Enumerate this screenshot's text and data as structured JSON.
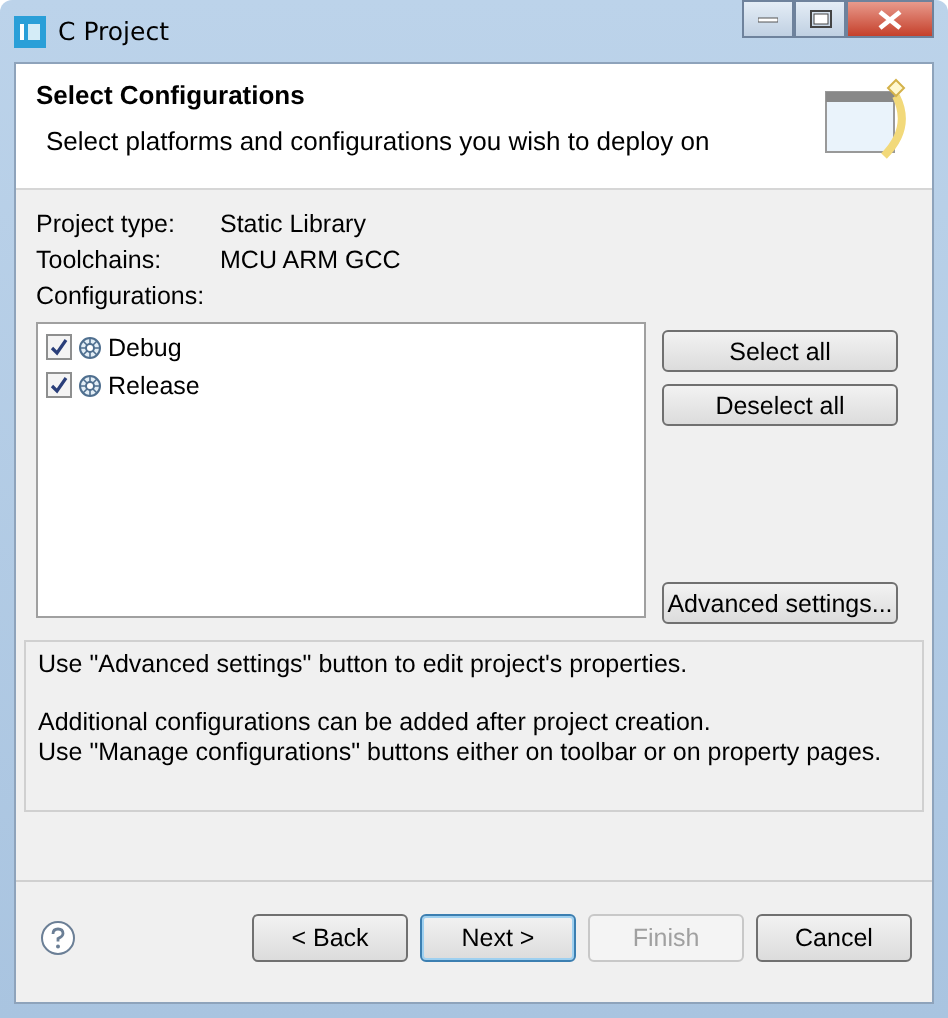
{
  "window": {
    "title": "C Project"
  },
  "header": {
    "title": "Select Configurations",
    "subtitle": "Select platforms and configurations you wish to deploy on"
  },
  "info": [
    {
      "label": "Project type:",
      "value": "Static Library"
    },
    {
      "label": "Toolchains:",
      "value": "MCU ARM GCC"
    }
  ],
  "configurations": {
    "label": "Configurations:",
    "items": [
      {
        "name": "Debug",
        "checked": true
      },
      {
        "name": "Release",
        "checked": true
      }
    ]
  },
  "side_buttons": [
    "Select all",
    "Deselect all",
    "Advanced settings..."
  ],
  "messages": [
    "Use \"Advanced settings\" button to edit project's properties.",
    "Additional configurations can be added after project creation.",
    "Use \"Manage configurations\" buttons either on toolbar or on property pages."
  ],
  "buttons": [
    {
      "label": "< Back",
      "disabled": false,
      "default": false
    },
    {
      "label": "Next >",
      "disabled": false,
      "default": true
    },
    {
      "label": "Finish",
      "disabled": true,
      "default": false
    },
    {
      "label": "Cancel",
      "disabled": false,
      "default": false
    }
  ]
}
